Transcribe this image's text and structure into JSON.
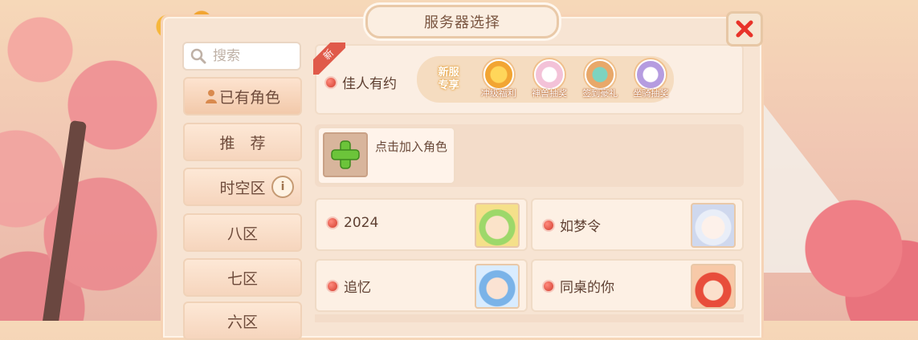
{
  "title": "服务器选择",
  "search": {
    "placeholder": "搜索"
  },
  "sidebar": {
    "items": [
      {
        "label": "已有角色"
      },
      {
        "label": "推　荐"
      },
      {
        "label": "时空区"
      },
      {
        "label": "八区"
      },
      {
        "label": "七区"
      },
      {
        "label": "六区"
      }
    ],
    "info_glyph": "i"
  },
  "recommended": {
    "badge": "新",
    "server_name": "佳人有约",
    "promo_tag": "新服\n专享",
    "promo_tag_lines": [
      "新服",
      "专享"
    ],
    "promos": [
      {
        "label": "冲级福利",
        "icon": "gold-ingot-icon"
      },
      {
        "label": "神兽抽奖",
        "icon": "egg-icon"
      },
      {
        "label": "签到豪礼",
        "icon": "gift-icon"
      },
      {
        "label": "坐骑抽奖",
        "icon": "unicorn-icon"
      }
    ]
  },
  "add_role": {
    "label": "点击加入角色"
  },
  "servers": [
    {
      "name": "2024"
    },
    {
      "name": "如梦令"
    },
    {
      "name": "追忆"
    },
    {
      "name": "同桌的你"
    }
  ],
  "colors": {
    "status": "#d23c2d",
    "accent": "#7a5540",
    "plus": "#6cc43a"
  }
}
